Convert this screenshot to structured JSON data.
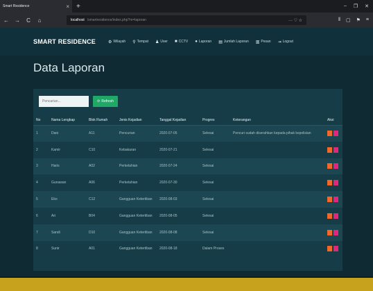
{
  "browser": {
    "tab_title": "Smart Residence",
    "tab_close": "×",
    "new_tab": "+",
    "url_host": "localhost",
    "url_rest": "/smartresidence/index.php?m=laporan",
    "url_end": "··· ♡ ☆",
    "nav": {
      "back": "←",
      "forward": "→",
      "reload": "C",
      "home": "⌂"
    },
    "window_controls": [
      "–",
      "❐",
      "✕"
    ],
    "right_buttons": [
      "⫴",
      "▢",
      "⚑",
      "≡"
    ]
  },
  "app": {
    "brand": "SMART RESIDENCE",
    "menu": [
      {
        "icon": "⚙",
        "label": "Wilayah"
      },
      {
        "icon": "⚲",
        "label": "Tempat"
      },
      {
        "icon": "♟",
        "label": "User"
      },
      {
        "icon": "■",
        "label": "CCTV"
      },
      {
        "icon": "●",
        "label": "Laporan"
      },
      {
        "icon": "▤",
        "label": "Jumlah Laporan"
      },
      {
        "icon": "▥",
        "label": "Pesan"
      },
      {
        "icon": "⇥",
        "label": "Logout"
      }
    ]
  },
  "page": {
    "title": "Data Laporan",
    "search_placeholder": "Pencarian...",
    "refresh_label": "Refresh"
  },
  "table": {
    "headers": [
      "No",
      "Nama Lengkap",
      "Blok Rumah",
      "Jenis Kejadian",
      "Tanggal Kejadian",
      "Progres",
      "Keterangan",
      "Aksi"
    ],
    "rows": [
      [
        "1",
        "Dani",
        "A11",
        "Pencurian",
        "2020-07-05",
        "Selesai",
        "Pencuri sudah diserahkan kepada pihak kepolisian"
      ],
      [
        "2",
        "Kamir",
        "C10",
        "Kebakaran",
        "2020-07-21",
        "Selesai",
        ""
      ],
      [
        "3",
        "Haris",
        "A02",
        "Perkelahian",
        "2020-07-24",
        "Selesai",
        ""
      ],
      [
        "4",
        "Gunawan",
        "A06",
        "Perkelahian",
        "2020-07-30",
        "Selesai",
        ""
      ],
      [
        "5",
        "Eko",
        "C12",
        "Gangguan Ketertiban",
        "2020-08-03",
        "Selesai",
        ""
      ],
      [
        "6",
        "Ari",
        "B04",
        "Gangguan Ketertiban",
        "2020-08-05",
        "Selesai",
        ""
      ],
      [
        "7",
        "Sandi",
        "D10",
        "Gangguan Ketertiban",
        "2020-08-08",
        "Selesai",
        ""
      ],
      [
        "8",
        "Sunir",
        "A01",
        "Gangguan Ketertiban",
        "2020-08-18",
        "Dalam Proses",
        ""
      ]
    ]
  },
  "colors": {
    "edit": "#f0682b",
    "delete": "#e0277a",
    "refresh": "#1fa866",
    "footer": "#c7a21c"
  }
}
